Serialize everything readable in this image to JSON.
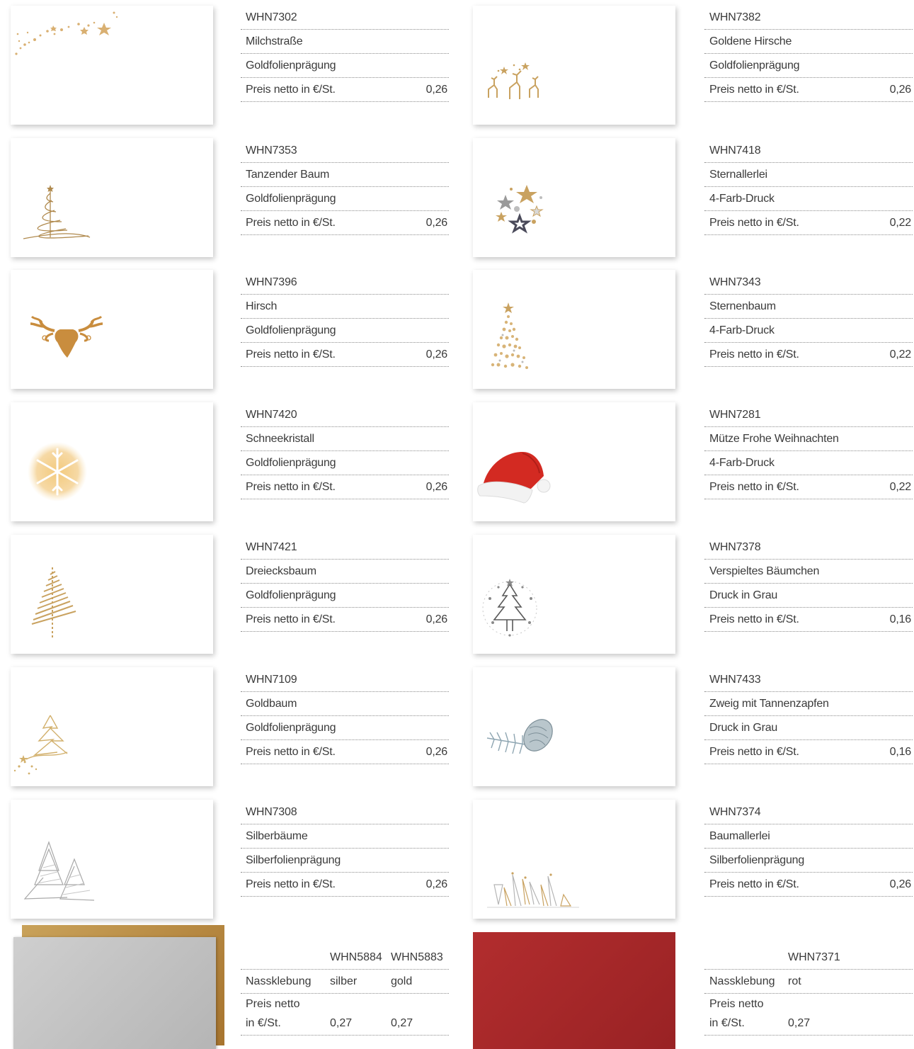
{
  "left_products": [
    {
      "code": "WHN7302",
      "name": "Milchstraße",
      "finish": "Goldfolienprägung",
      "price_label": "Preis netto in €/St.",
      "price": "0,26",
      "icon": "shooting-star-icon"
    },
    {
      "code": "WHN7353",
      "name": "Tanzender Baum",
      "finish": "Goldfolienprägung",
      "price_label": "Preis netto in €/St.",
      "price": "0,26",
      "icon": "swirl-tree-icon"
    },
    {
      "code": "WHN7396",
      "name": "Hirsch",
      "finish": "Goldfolienprägung",
      "price_label": "Preis netto in €/St.",
      "price": "0,26",
      "icon": "deer-head-icon"
    },
    {
      "code": "WHN7420",
      "name": "Schneekristall",
      "finish": "Goldfolienprägung",
      "price_label": "Preis netto in €/St.",
      "price": "0,26",
      "icon": "snowflake-icon"
    },
    {
      "code": "WHN7421",
      "name": "Dreiecksbaum",
      "finish": "Goldfolienprägung",
      "price_label": "Preis netto in €/St.",
      "price": "0,26",
      "icon": "triangle-tree-icon"
    },
    {
      "code": "WHN7109",
      "name": "Goldbaum",
      "finish": "Goldfolienprägung",
      "price_label": "Preis netto in €/St.",
      "price": "0,26",
      "icon": "gold-tree-icon"
    },
    {
      "code": "WHN7308",
      "name": "Silberbäume",
      "finish": "Silberfolienprägung",
      "price_label": "Preis netto in €/St.",
      "price": "0,26",
      "icon": "silver-trees-icon"
    }
  ],
  "right_products": [
    {
      "code": "WHN7382",
      "name": "Goldene Hirsche",
      "finish": "Goldfolienprägung",
      "price_label": "Preis netto in €/St.",
      "price": "0,26",
      "icon": "golden-deer-icon"
    },
    {
      "code": "WHN7418",
      "name": "Sternallerlei",
      "finish": "4-Farb-Druck",
      "price_label": "Preis netto in €/St.",
      "price": "0,22",
      "icon": "star-cluster-icon"
    },
    {
      "code": "WHN7343",
      "name": "Sternenbaum",
      "finish": "4-Farb-Druck",
      "price_label": "Preis netto in €/St.",
      "price": "0,22",
      "icon": "star-tree-icon"
    },
    {
      "code": "WHN7281",
      "name": "Mütze Frohe Weihnachten",
      "finish": "4-Farb-Druck",
      "price_label": "Preis netto in €/St.",
      "price": "0,22",
      "icon": "santa-hat-icon"
    },
    {
      "code": "WHN7378",
      "name": "Verspieltes Bäumchen",
      "finish": "Druck in Grau",
      "price_label": "Preis netto in €/St.",
      "price": "0,16",
      "icon": "playful-tree-icon"
    },
    {
      "code": "WHN7433",
      "name": "Zweig mit Tannenzapfen",
      "finish": "Druck in Grau",
      "price_label": "Preis netto in €/St.",
      "price": "0,16",
      "icon": "pine-cone-icon"
    },
    {
      "code": "WHN7374",
      "name": "Baumallerlei",
      "finish": "Silberfolienprägung",
      "price_label": "Preis netto in €/St.",
      "price": "0,26",
      "icon": "tree-row-icon"
    }
  ],
  "bottom_left": {
    "codes": [
      "WHN5884",
      "WHN5883"
    ],
    "seal_label": "Nassklebung",
    "colors": [
      "silber",
      "gold"
    ],
    "price_label_1": "Preis netto",
    "price_label_2": "in €/St.",
    "prices": [
      "0,27",
      "0,27"
    ],
    "swatches": [
      "#c4c4c4",
      "#b8873d"
    ]
  },
  "bottom_right": {
    "code": "WHN7371",
    "seal_label": "Nassklebung",
    "color": "rot",
    "price_label_1": "Preis netto",
    "price_label_2": "in €/St.",
    "price": "0,27",
    "swatch": "#a4272a"
  },
  "colors": {
    "gold": "#c9a260",
    "deer": "#c98d3e",
    "red": "#d32a22",
    "grey": "#6f6f6f",
    "silver": "#a9a9a9"
  }
}
